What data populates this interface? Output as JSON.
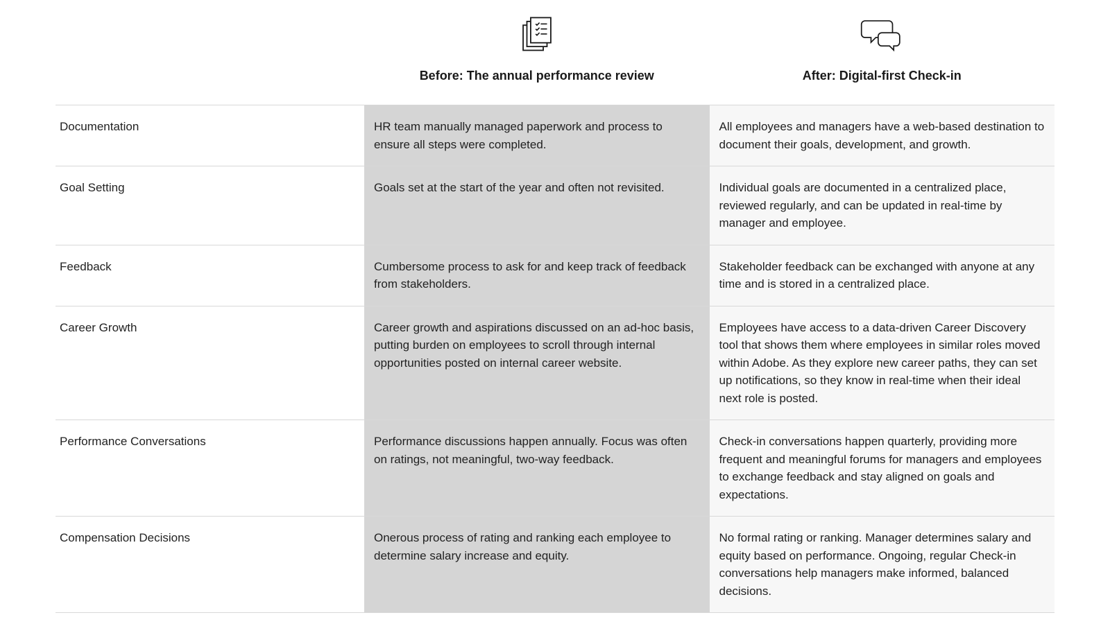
{
  "headers": {
    "before": "Before: The annual performance review",
    "after": "After: Digital-first Check-in"
  },
  "rows": [
    {
      "label": "Documentation",
      "before": "HR team manually managed paperwork and process to ensure all steps were completed.",
      "after": "All employees and managers have a web-based destination to document their goals, development, and growth."
    },
    {
      "label": "Goal Setting",
      "before": "Goals set at the start of the year and often not revisited.",
      "after": "Individual goals are documented in a centralized place, reviewed regularly, and can be updated in real-time by manager and employee."
    },
    {
      "label": "Feedback",
      "before": "Cumbersome process to ask for and keep track of feedback from stakeholders.",
      "after": "Stakeholder feedback can be exchanged with anyone at any time and is stored in a centralized place."
    },
    {
      "label": "Career Growth",
      "before": "Career growth and aspirations discussed on an ad-hoc basis, putting burden on employees to scroll through internal opportunities posted on internal career website.",
      "after": "Employees have access to a data-driven Career Discovery tool that shows them where employees in similar roles moved within Adobe. As they explore new career paths, they can set up notifications, so they know in real-time when their ideal next role is posted."
    },
    {
      "label": "Performance Conversations",
      "before": "Performance discussions happen annually. Focus was often on ratings, not meaningful, two-way feedback.",
      "after": "Check-in conversations happen quarterly, providing more frequent and meaningful forums for managers and employees to exchange feedback and stay aligned on goals and expectations."
    },
    {
      "label": "Compensation Decisions",
      "before": "Onerous process of rating and ranking each employee to determine salary increase and equity.",
      "after": "No formal rating or ranking. Manager determines salary and equity based on performance. Ongoing, regular Check-in conversations help managers make informed, balanced decisions."
    }
  ]
}
